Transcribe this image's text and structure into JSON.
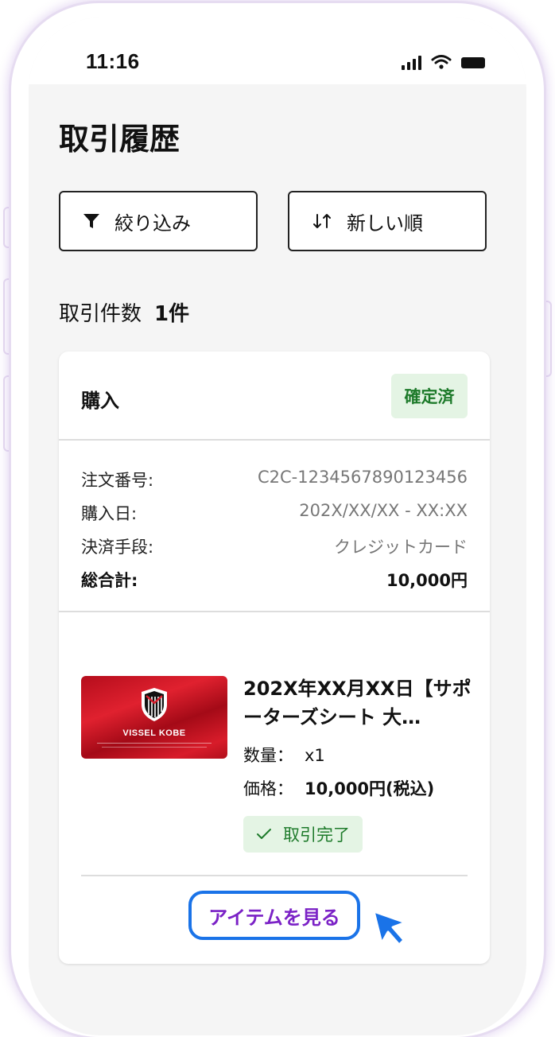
{
  "status_bar": {
    "time": "11:16"
  },
  "page": {
    "title": "取引履歴"
  },
  "toolbar": {
    "filter_label": "絞り込み",
    "sort_label": "新しい順"
  },
  "summary": {
    "count_label": "取引件数",
    "count_value": "1件"
  },
  "transaction": {
    "type": "購入",
    "status_badge": "確定済",
    "details": [
      {
        "key": "注文番号:",
        "value": "C2C-1234567890123456"
      },
      {
        "key": "購入日:",
        "value": "202X/XX/XX - XX:XX"
      },
      {
        "key": "決済手段:",
        "value": "クレジットカード"
      },
      {
        "key": "総合計:",
        "value": "10,000円"
      }
    ],
    "item": {
      "thumbnail_brand": "VISSEL KOBE",
      "title": "202X年XX月XX日【サポーターズシート 大…",
      "qty_label": "数量：",
      "qty_value": "x1",
      "price_label": "価格：",
      "price_value": "10,000円(税込)",
      "status": "取引完了",
      "view_button": "アイテムを見る"
    }
  },
  "colors": {
    "accent_blue": "#1a73e8",
    "link_purple": "#7b22c6",
    "success_green": "#1d7a2a",
    "success_bg": "#e4f4e4"
  },
  "icons": {
    "filter": "filter-icon",
    "sort": "sort-icon",
    "check": "check-icon",
    "cursor": "pointer-cursor-icon"
  }
}
